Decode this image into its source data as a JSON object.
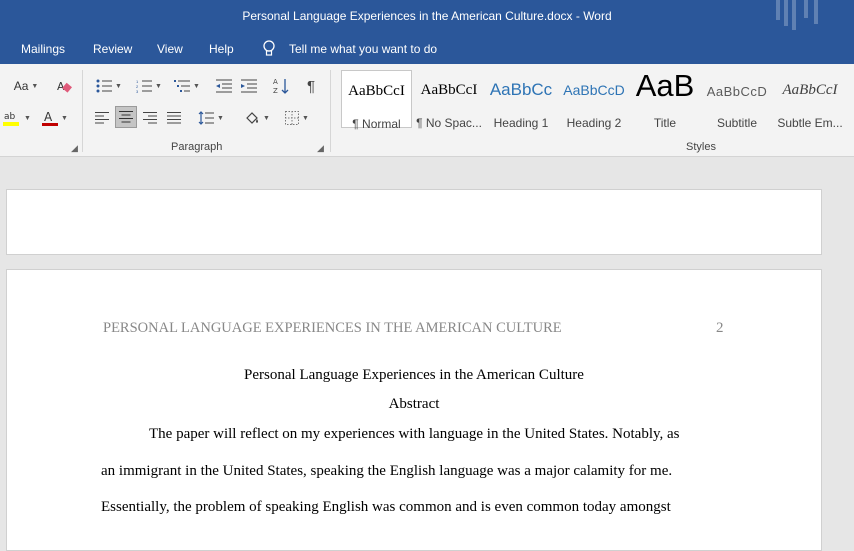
{
  "window": {
    "title": "Personal Language Experiences in the American Culture.docx  -  Word"
  },
  "tabs": [
    "Mailings",
    "Review",
    "View",
    "Help"
  ],
  "tell_me": "Tell me what you want to do",
  "ribbon": {
    "font_size_label": "Aa",
    "groups": {
      "paragraph": "Paragraph",
      "styles": "Styles"
    },
    "styles": [
      {
        "sample": "AaBbCcI",
        "name": "¶ Normal"
      },
      {
        "sample": "AaBbCcI",
        "name": "¶ No Spac..."
      },
      {
        "sample": "AaBbCc",
        "name": "Heading 1"
      },
      {
        "sample": "AaBbCcD",
        "name": "Heading 2"
      },
      {
        "sample": "AaB",
        "name": "Title"
      },
      {
        "sample": "AaBbCcD",
        "name": "Subtitle"
      },
      {
        "sample": "AaBbCcI",
        "name": "Subtle Em..."
      }
    ]
  },
  "document": {
    "running_head": "PERSONAL LANGUAGE EXPERIENCES IN THE AMERICAN CULTURE",
    "page_number": "2",
    "title": "Personal Language Experiences in the American Culture",
    "abstract_heading": "Abstract",
    "lines": [
      "The paper will reflect on my experiences with language in the United States. Notably, as",
      "an immigrant in the United States, speaking the English language was a major calamity for me.",
      "Essentially, the problem of speaking English was common and is even common today amongst"
    ]
  },
  "colors": {
    "title_bar": "#2b579a",
    "heading_blue": "#2e74b5",
    "highlight": "#ffff00",
    "font_color": "#c00000"
  }
}
